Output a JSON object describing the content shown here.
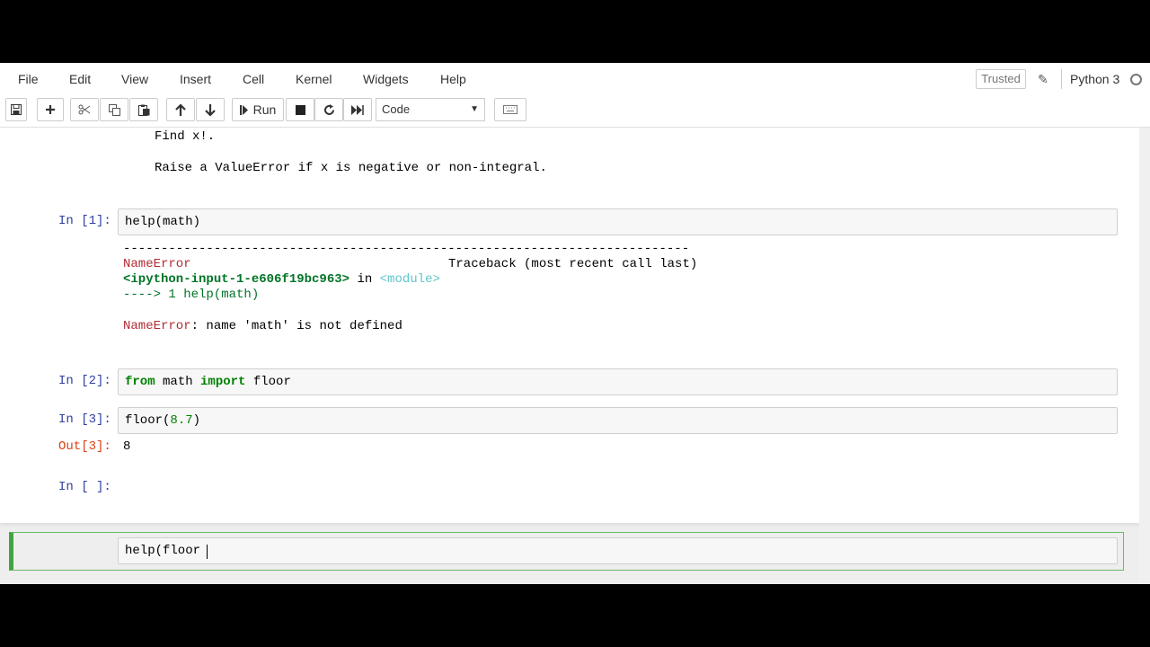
{
  "menubar": {
    "items": [
      {
        "label": "File"
      },
      {
        "label": "Edit"
      },
      {
        "label": "View"
      },
      {
        "label": "Insert"
      },
      {
        "label": "Cell"
      },
      {
        "label": "Kernel"
      },
      {
        "label": "Widgets"
      },
      {
        "label": "Help"
      }
    ],
    "trusted_label": "Trusted",
    "kernel_name": "Python 3"
  },
  "toolbar": {
    "run_label": "Run",
    "cell_type": "Code",
    "icons": [
      "save-icon",
      "plus-icon",
      "scissors-icon",
      "copy-icon",
      "paste-icon",
      "arrow-up-icon",
      "arrow-down-icon",
      "run-icon",
      "stop-icon",
      "restart-icon",
      "fast-forward-icon",
      "keyboard-icon"
    ]
  },
  "doc_output": {
    "line1": "Find x!.",
    "line2": "Raise a ValueError if x is negative or non-integral."
  },
  "cells": [
    {
      "prompt": "In [1]:",
      "code": "help(math)",
      "error": {
        "dashes": "---------------------------------------------------------------------------",
        "name": "NameError",
        "traceback_header": "Traceback (most recent call last)",
        "location": "<ipython-input-1-e606f19bc963>",
        "in_word": " in ",
        "module": "<module>",
        "arrow_line": "----> 1 help(math)",
        "message_name": "NameError",
        "message": ": name 'math' is not defined"
      }
    },
    {
      "prompt": "In [2]:",
      "code_kw1": "from",
      "code_mid": " math ",
      "code_kw2": "import",
      "code_end": " floor"
    },
    {
      "prompt": "In [3]:",
      "code_fn": "floor(",
      "code_num": "8.7",
      "code_close": ")",
      "out_prompt": "Out[3]:",
      "out_value": "8"
    },
    {
      "prompt": "In [ ]:",
      "code": "help(floor"
    }
  ],
  "colors": {
    "prompt_in": "#303f9f",
    "prompt_out": "#d84315",
    "selected_border": "#42a541"
  }
}
